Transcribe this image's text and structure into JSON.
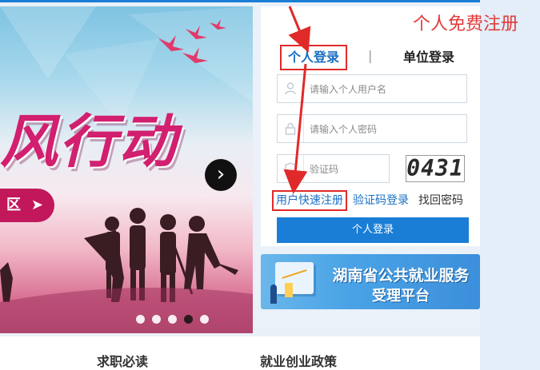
{
  "banner": {
    "headline": "风行动",
    "tag_text": "区",
    "tag_icon": "paper-plane-icon",
    "next_icon": "chevron-right-icon",
    "slide_count": 5,
    "active_slide": 4
  },
  "login": {
    "tabs": [
      "个人登录",
      "单位登录"
    ],
    "active_tab": "个人登录",
    "separator": "|",
    "username_placeholder": "请输入个人用户名",
    "password_placeholder": "请输入个人密码",
    "code_placeholder": "验证码",
    "captcha_text": "0431",
    "links": {
      "register": "用户快速注册",
      "code_login": "验证码登录",
      "forgot": "找回密码"
    },
    "submit_label": "个人登录",
    "accent_color": "#1a7ed6"
  },
  "annotation": {
    "cta_text": "个人免费注册",
    "color": "#e23b3b"
  },
  "service_banner": {
    "line1": "湖南省公共就业服务",
    "line2": "受理平台"
  },
  "bottom_nav": {
    "items": [
      "求职必读",
      "就业创业政策"
    ]
  }
}
